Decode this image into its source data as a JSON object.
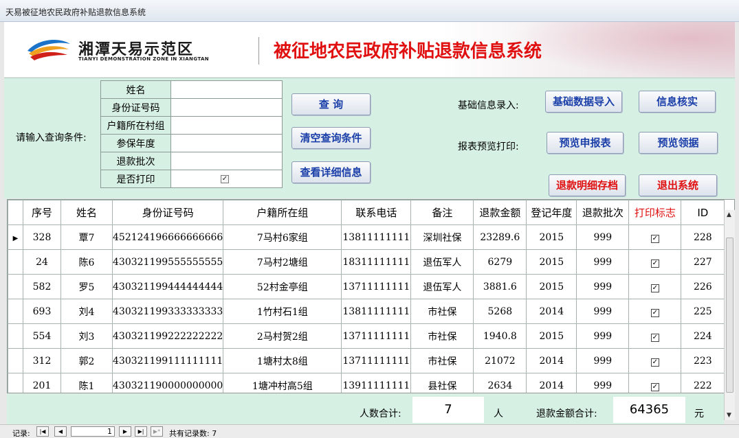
{
  "window": {
    "title": "天易被征地农民政府补贴退款信息系统"
  },
  "banner": {
    "logo_cn": "湘潭天易示范区",
    "logo_en": "TIANYI DEMONSTRATION ZONE IN XIANGTAN",
    "system_title": "被征地农民政府补贴退款信息系统"
  },
  "query": {
    "label": "请输入查询条件:",
    "fields": [
      {
        "label": "姓名",
        "value": ""
      },
      {
        "label": "身份证号码",
        "value": ""
      },
      {
        "label": "户籍所在村组",
        "value": ""
      },
      {
        "label": "参保年度",
        "value": ""
      },
      {
        "label": "退款批次",
        "value": ""
      },
      {
        "label": "是否打印",
        "value": ""
      }
    ],
    "printed_checked": "✓",
    "buttons": {
      "search": "查 询",
      "clear": "清空查询条件",
      "detail": "查看详细信息"
    }
  },
  "right_panel": {
    "basic_label": "基础信息录入:",
    "report_label": "报表预览打印:",
    "buttons": {
      "import": "基础数据导入",
      "verify": "信息核实",
      "preview_report": "预览申报表",
      "preview_receipt": "预览领据",
      "archive": "退款明细存档",
      "exit": "退出系统"
    }
  },
  "grid": {
    "columns": [
      "序号",
      "姓名",
      "身份证号码",
      "户籍所在组",
      "联系电话",
      "备注",
      "退款金额",
      "登记年度",
      "退款批次",
      "打印标志",
      "ID"
    ],
    "check_mark": "✓",
    "row_pointer": "▶",
    "rows": [
      [
        "328",
        "覃7",
        "452124196666666666",
        "7马村6家组",
        "13811111111",
        "深圳社保",
        "23289.6",
        "2015",
        "999",
        "✓",
        "228"
      ],
      [
        "24",
        "陈6",
        "430321199555555555",
        "7马村2塘组",
        "18311111111",
        "退伍军人",
        "6279",
        "2015",
        "999",
        "✓",
        "227"
      ],
      [
        "582",
        "罗5",
        "430321199444444444",
        "52村金亭组",
        "13711111111",
        "退伍军人",
        "3881.6",
        "2015",
        "999",
        "✓",
        "226"
      ],
      [
        "693",
        "刘4",
        "430321199333333333",
        "1竹村石1组",
        "13811111111",
        "市社保",
        "5268",
        "2014",
        "999",
        "✓",
        "225"
      ],
      [
        "554",
        "刘3",
        "430321199222222222",
        "2马村贺2组",
        "13711111111",
        "市社保",
        "1940.8",
        "2015",
        "999",
        "✓",
        "224"
      ],
      [
        "312",
        "郭2",
        "430321199111111111",
        "1塘村太8组",
        "13711111111",
        "市社保",
        "21072",
        "2014",
        "999",
        "✓",
        "223"
      ],
      [
        "201",
        "陈1",
        "430321190000000000",
        "1塘冲村高5组",
        "13911111111",
        "县社保",
        "2634",
        "2014",
        "999",
        "✓",
        "222"
      ]
    ]
  },
  "summary": {
    "people_label": "人数合计:",
    "people_value": "7",
    "people_unit": "人",
    "amount_label": "退款金额合计:",
    "amount_value": "64365",
    "amount_unit": "元"
  },
  "navigator": {
    "record_label": "记录:",
    "current": "1",
    "total_label": "共有记录数: 7",
    "first": "|◀",
    "prev": "◀",
    "next": "▶",
    "last": "▶|",
    "new": "▶*"
  },
  "colors": {
    "title_red": "#e01010",
    "button_blue": "#1b3fa8",
    "panel_green": "#d7f0e4"
  }
}
